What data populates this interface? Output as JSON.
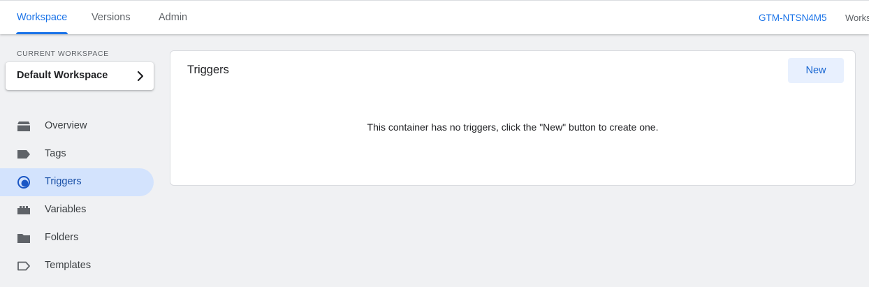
{
  "header": {
    "tabs": [
      {
        "label": "Workspace",
        "active": true
      },
      {
        "label": "Versions",
        "active": false
      },
      {
        "label": "Admin",
        "active": false
      }
    ],
    "container_id": "GTM-NTSN4M5",
    "workspace_clip": "Works"
  },
  "sidebar": {
    "current_workspace_label": "CURRENT WORKSPACE",
    "workspace_name": "Default Workspace",
    "items": [
      {
        "label": "Overview",
        "icon": "overview-icon",
        "active": false
      },
      {
        "label": "Tags",
        "icon": "tag-icon",
        "active": false
      },
      {
        "label": "Triggers",
        "icon": "trigger-icon",
        "active": true
      },
      {
        "label": "Variables",
        "icon": "variables-icon",
        "active": false
      },
      {
        "label": "Folders",
        "icon": "folder-icon",
        "active": false
      },
      {
        "label": "Templates",
        "icon": "template-icon",
        "active": false
      }
    ]
  },
  "main": {
    "title": "Triggers",
    "new_button_label": "New",
    "empty_message": "This container has no triggers, click the \"New\" button to create one."
  },
  "colors": {
    "accent": "#1a73e8",
    "active_nav_bg": "#d3e3fd",
    "page_bg": "#f0f1f3",
    "icon_gray": "#5f6368"
  }
}
